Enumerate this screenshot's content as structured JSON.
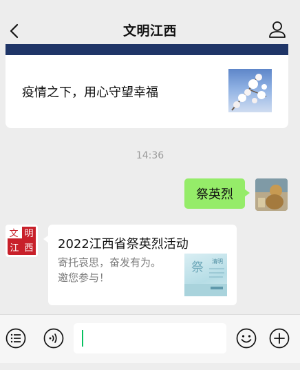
{
  "header": {
    "title": "文明江西",
    "back_icon": "chevron-left-icon",
    "profile_icon": "person-icon"
  },
  "article_card": {
    "headline": "疫情之下，用心守望幸福",
    "thumbnail": "white-blossom-photo"
  },
  "timestamp": "14:36",
  "sent_message": {
    "text": "祭英烈",
    "bubble_color": "#95ec69"
  },
  "sender_avatar": {
    "chars": [
      "文",
      "明",
      "江",
      "西"
    ],
    "color": "#c8202a"
  },
  "link_card": {
    "title": "2022江西省祭英烈活动",
    "desc_line1": "寄托哀思，奋发有为。",
    "desc_line2": "邀您参与！",
    "thumb_text_a": "祭",
    "thumb_text_b": "清明"
  },
  "input_bar": {
    "list_icon": "list-menu-icon",
    "voice_icon": "voice-icon",
    "emoji_icon": "emoji-icon",
    "add_icon": "plus-icon",
    "value": "",
    "accent": "#07c160"
  }
}
